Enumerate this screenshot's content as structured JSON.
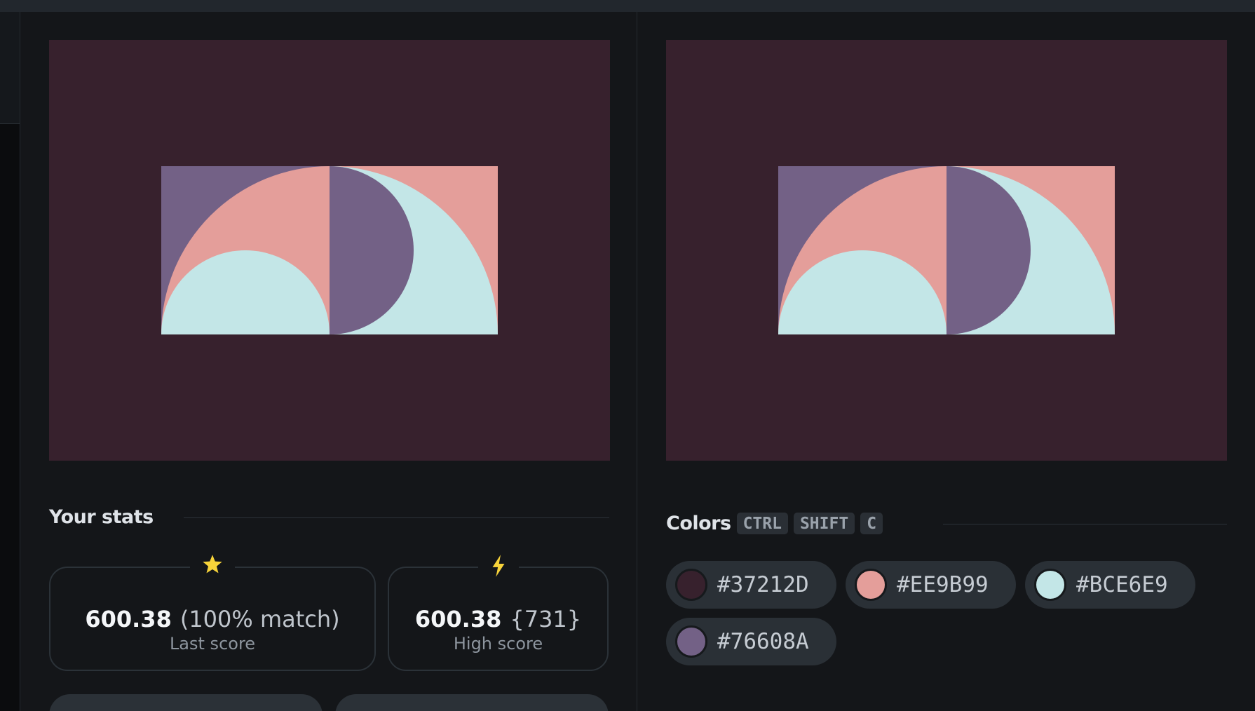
{
  "stats": {
    "title": "Your stats",
    "last": {
      "value": "600.38",
      "extra": "(100% match)",
      "label": "Last score",
      "icon": "star-icon"
    },
    "high": {
      "value": "600.38",
      "extra": "{731}",
      "label": "High score",
      "icon": "lightning-icon"
    }
  },
  "colors": {
    "title": "Colors",
    "shortcut": [
      "CTRL",
      "SHIFT",
      "C"
    ],
    "swatches": [
      {
        "hex": "#37212D",
        "color": "#37212D"
      },
      {
        "hex": "#EE9B99",
        "color": "#E49E9A"
      },
      {
        "hex": "#BCE6E9",
        "color": "#C3E6E7"
      },
      {
        "hex": "#76608A",
        "color": "#736186"
      }
    ]
  },
  "palette": {
    "background": "#37212D",
    "pink": "#E49E9A",
    "cyan": "#C3E6E7",
    "purple": "#736186",
    "accent_star": "#F7D33A",
    "page_bg": "#141619"
  }
}
